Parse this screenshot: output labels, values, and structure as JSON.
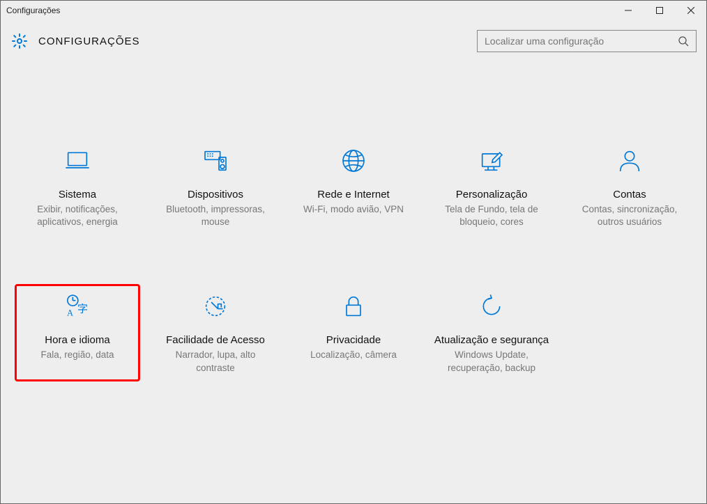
{
  "window_title": "Configurações",
  "header": {
    "title": "CONFIGURAÇÕES",
    "search_placeholder": "Localizar uma configuração"
  },
  "tiles": [
    {
      "name": "Sistema",
      "desc": "Exibir, notificações, aplicativos, energia",
      "highlight": false
    },
    {
      "name": "Dispositivos",
      "desc": "Bluetooth, impressoras, mouse",
      "highlight": false
    },
    {
      "name": "Rede e Internet",
      "desc": "Wi-Fi, modo avião, VPN",
      "highlight": false
    },
    {
      "name": "Personalização",
      "desc": "Tela de Fundo, tela de bloqueio, cores",
      "highlight": false
    },
    {
      "name": "Contas",
      "desc": "Contas, sincronização, outros usuários",
      "highlight": false
    },
    {
      "name": "Hora e idioma",
      "desc": "Fala, região, data",
      "highlight": true
    },
    {
      "name": "Facilidade de Acesso",
      "desc": "Narrador, lupa, alto contraste",
      "highlight": false
    },
    {
      "name": "Privacidade",
      "desc": "Localização, câmera",
      "highlight": false
    },
    {
      "name": "Atualização e segurança",
      "desc": "Windows Update, recuperação, backup",
      "highlight": false
    }
  ],
  "accent_color": "#0078d7"
}
